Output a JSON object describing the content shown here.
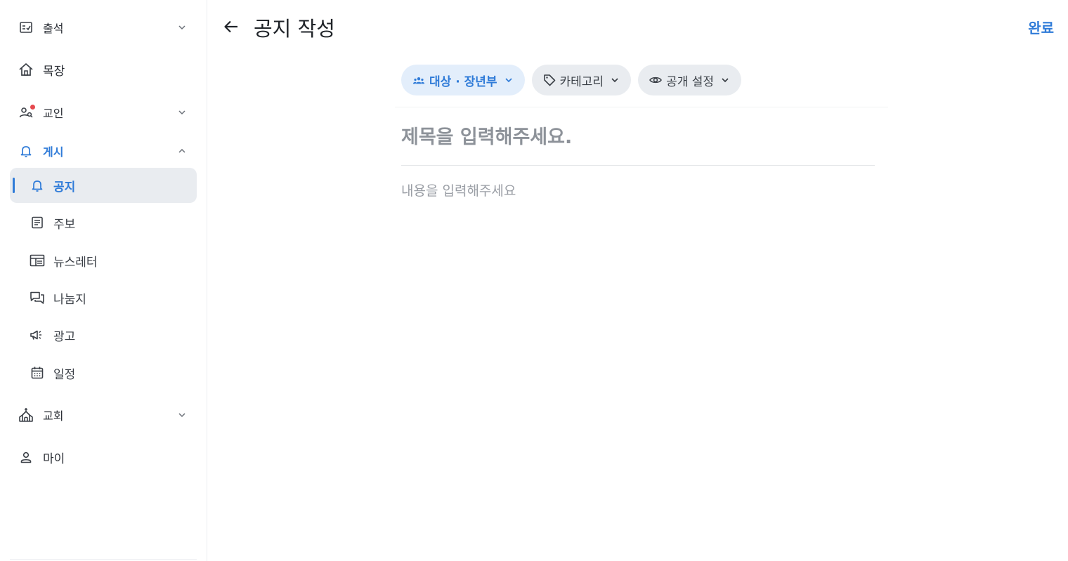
{
  "sidebar": {
    "attendance": {
      "label": "출석"
    },
    "mokjang": {
      "label": "목장"
    },
    "members": {
      "label": "교인"
    },
    "board": {
      "label": "게시",
      "items": [
        {
          "label": "공지"
        },
        {
          "label": "주보"
        },
        {
          "label": "뉴스레터"
        },
        {
          "label": "나눔지"
        },
        {
          "label": "광고"
        },
        {
          "label": "일정"
        }
      ]
    },
    "church": {
      "label": "교회"
    },
    "my": {
      "label": "마이"
    }
  },
  "header": {
    "title": "공지 작성",
    "done_label": "완료"
  },
  "chips": {
    "target": "대상 · 장년부",
    "category": "카테고리",
    "visibility": "공개 설정"
  },
  "editor": {
    "title_placeholder": "제목을 입력해주세요.",
    "title_value": "",
    "body_placeholder": "내용을 입력해주세요",
    "body_value": ""
  },
  "colors": {
    "accent": "#2f7bd8",
    "selected_bg": "#e9ecf0",
    "chip_active_bg": "#e3eefb",
    "badge": "#e5484d"
  }
}
